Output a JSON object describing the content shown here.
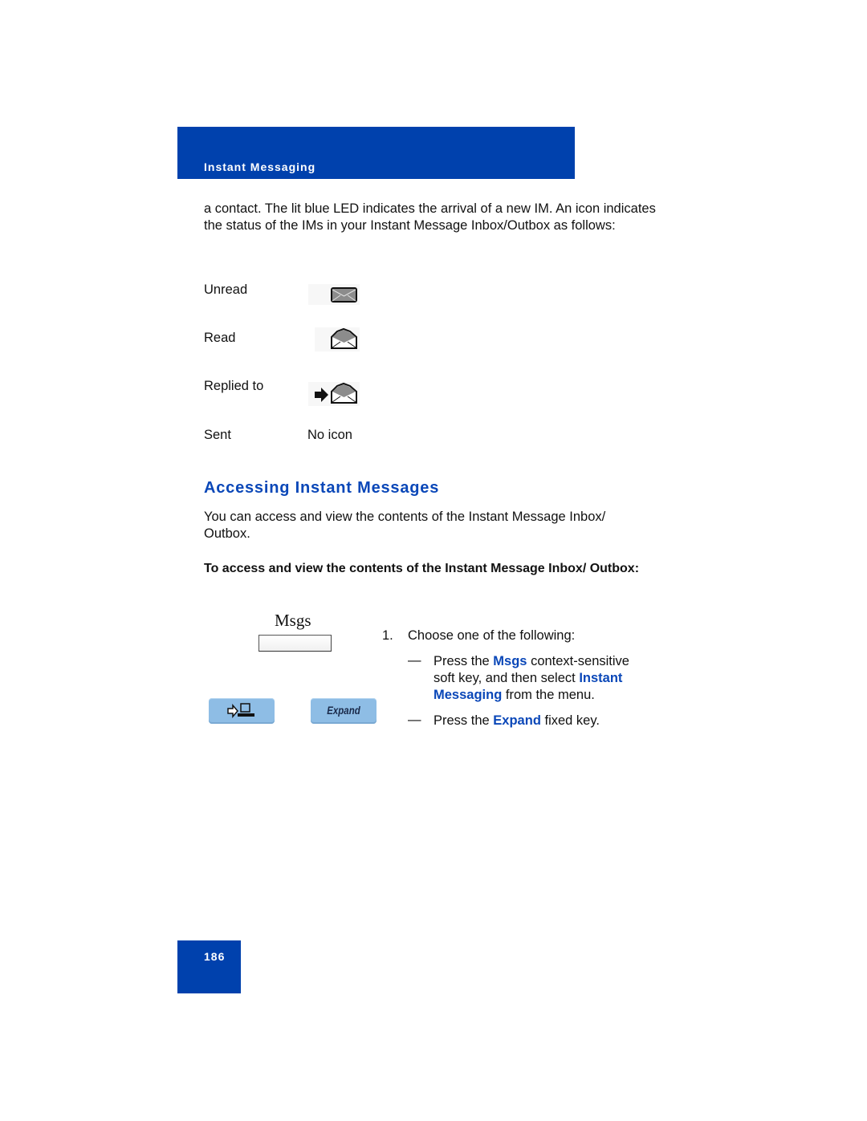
{
  "header": {
    "section_title": "Instant Messaging"
  },
  "intro_paragraph": "a contact. The lit blue LED indicates the arrival of a new IM. An icon indicates the status of the IMs in your Instant Message Inbox/Outbox as follows:",
  "status_icons": [
    {
      "label": "Unread",
      "icon": "closed-envelope-icon"
    },
    {
      "label": "Read",
      "icon": "open-envelope-icon"
    },
    {
      "label": "Replied to",
      "icon": "reply-arrow-open-envelope-icon"
    },
    {
      "label": "Sent",
      "icon": "none",
      "icon_text": "No icon"
    }
  ],
  "section": {
    "heading": "Accessing Instant Messages",
    "paragraph": "You can access and view the contents of the Instant Message Inbox/ Outbox.",
    "procedure_heading": "To access and view the contents of the Instant Message Inbox/ Outbox:"
  },
  "illustration": {
    "softkey_label": "Msgs",
    "left_key_icon": "arrow-to-computer-icon",
    "right_key_label": "Expand"
  },
  "steps": [
    {
      "number": "1.",
      "text": "Choose one of the following:",
      "options": [
        {
          "dash": "—",
          "parts": {
            "a": "Press the ",
            "b": "Msgs",
            "c": " context-sensitive soft key, and then select ",
            "d": "Instant Messaging",
            "e": " from the menu."
          }
        },
        {
          "dash": "—",
          "parts": {
            "a": "Press the ",
            "b": "Expand",
            "c": " fixed key."
          }
        }
      ]
    }
  ],
  "footer": {
    "page_number": "186"
  },
  "colors": {
    "brand_blue": "#0041ad",
    "highlight_blue": "#0a47b8",
    "key_blue": "#8ebde5"
  }
}
